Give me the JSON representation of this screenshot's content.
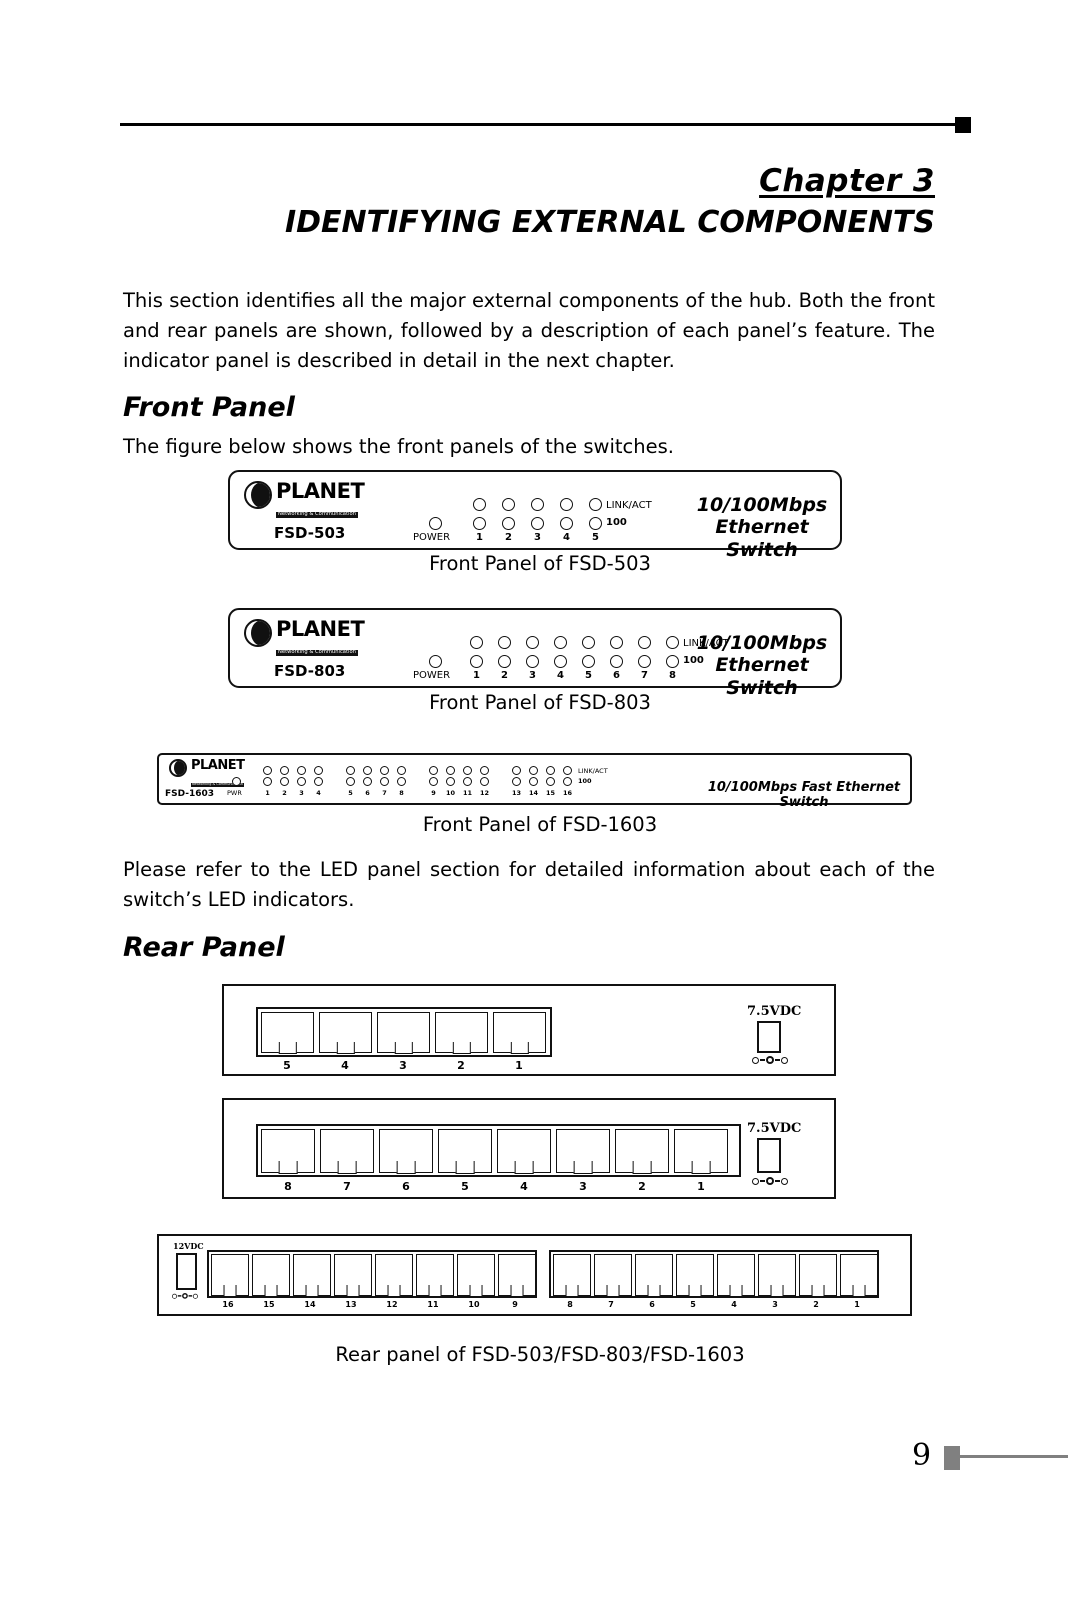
{
  "header": {
    "chapter_label": "Chapter 3",
    "chapter_title": "IDENTIFYING EXTERNAL COMPONENTS"
  },
  "body": {
    "intro": "This section identifies all the major external components of the hub. Both the front and rear panels are shown, followed by a description of each panel’s feature. The indicator panel is described in detail in the next chapter.",
    "front_panel_heading": "Front Panel",
    "front_panel_intro": "The figure below shows the front panels of the switches.",
    "led_note": "Please refer to the LED panel section for detailed information about each of the switch’s LED indicators.",
    "rear_panel_heading": "Rear Panel"
  },
  "captions": {
    "front_503": "Front Panel of FSD-503",
    "front_803": "Front Panel of FSD-803",
    "front_1603": "Front Panel of FSD-1603",
    "rear_all": "Rear panel of FSD-503/FSD-803/FSD-1603"
  },
  "logo": {
    "word": "PLANET",
    "tagline": "Networking & Communication"
  },
  "devices": {
    "fsd503": {
      "model": "FSD-503",
      "brand_line1": "10/100Mbps",
      "brand_line2": "Ethernet Switch",
      "power_label": "POWER",
      "link_act_label": "LINK/ACT",
      "speed_label": "100",
      "ports": [
        "1",
        "2",
        "3",
        "4",
        "5"
      ]
    },
    "fsd803": {
      "model": "FSD-803",
      "brand_line1": "10/100Mbps",
      "brand_line2": "Ethernet Switch",
      "power_label": "POWER",
      "link_act_label": "LINK/ACT",
      "speed_label": "100",
      "ports": [
        "1",
        "2",
        "3",
        "4",
        "5",
        "6",
        "7",
        "8"
      ]
    },
    "fsd1603": {
      "model": "FSD-1603",
      "brand_line1": "10/100Mbps Fast Ethernet Switch",
      "power_label": "PWR",
      "link_act_label": "LINK/ACT",
      "speed_label": "100",
      "ports": [
        "1",
        "2",
        "3",
        "4",
        "5",
        "6",
        "7",
        "8",
        "9",
        "10",
        "11",
        "12",
        "13",
        "14",
        "15",
        "16"
      ]
    }
  },
  "rear_panels": {
    "fsd503": {
      "dc_label": "7.5VDC",
      "ports": [
        "5",
        "4",
        "3",
        "2",
        "1"
      ]
    },
    "fsd803": {
      "dc_label": "7.5VDC",
      "ports": [
        "8",
        "7",
        "6",
        "5",
        "4",
        "3",
        "2",
        "1"
      ]
    },
    "fsd1603": {
      "dc_label": "12VDC",
      "ports_left": [
        "16",
        "15",
        "14",
        "13",
        "12",
        "11",
        "10",
        "9"
      ],
      "ports_right": [
        "8",
        "7",
        "6",
        "5",
        "4",
        "3",
        "2",
        "1"
      ]
    }
  },
  "footer": {
    "page_number": "9"
  },
  "colors": {
    "ink": "#000000",
    "footer_gray": "#808080"
  }
}
